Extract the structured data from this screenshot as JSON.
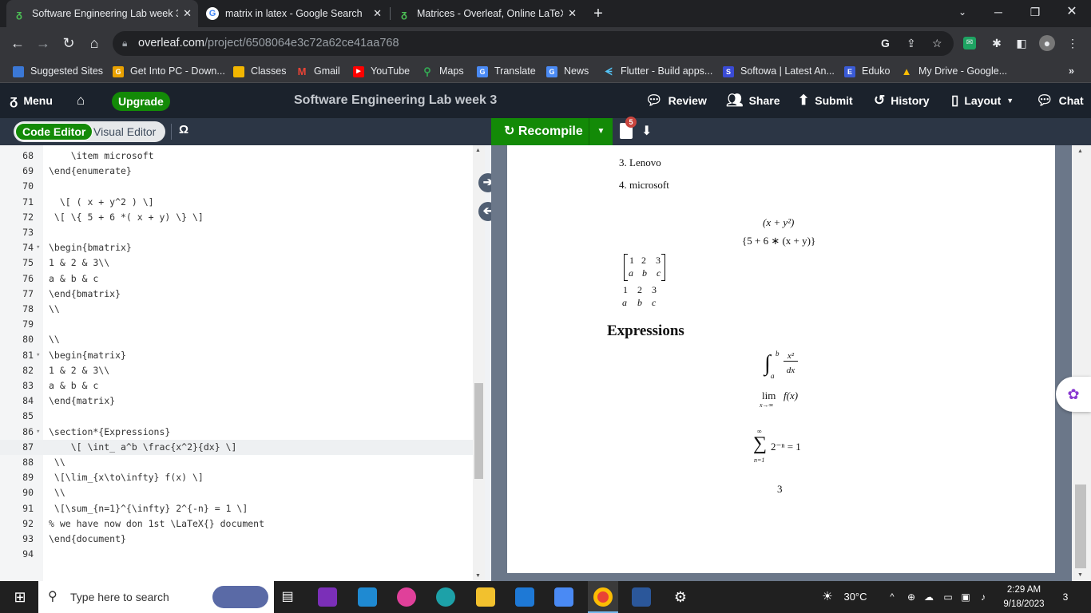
{
  "browser": {
    "tabs": [
      {
        "title": "Software Engineering Lab week 3",
        "icon": "overleaf-icon"
      },
      {
        "title": "matrix in latex - Google Search",
        "icon": "google-icon"
      },
      {
        "title": "Matrices - Overleaf, Online LaTeX",
        "icon": "overleaf-icon"
      }
    ],
    "url_host": "overleaf.com",
    "url_path": "/project/6508064e3c72a62ce41aa768",
    "bookmarks": [
      "Suggested Sites",
      "Get Into PC - Down...",
      "Classes",
      "Gmail",
      "YouTube",
      "Maps",
      "Translate",
      "News",
      "Flutter - Build apps...",
      "Softowa | Latest An...",
      "Eduko",
      "My Drive - Google..."
    ]
  },
  "overleaf": {
    "menu": "Menu",
    "upgrade": "Upgrade",
    "project_title": "Software Engineering Lab week 3",
    "review": "Review",
    "share": "Share",
    "submit": "Submit",
    "history": "History",
    "layout": "Layout",
    "chat": "Chat",
    "code_editor": "Code Editor",
    "visual_editor": "Visual Editor",
    "omega": "Ω",
    "recompile": "Recompile",
    "logs_badge": "5"
  },
  "editor": {
    "lines": [
      {
        "n": "68",
        "code": "    \\item microsoft"
      },
      {
        "n": "69",
        "code": "\\end{enumerate}"
      },
      {
        "n": "70",
        "code": ""
      },
      {
        "n": "71",
        "code": "  \\[ ( x + y^2 ) \\]"
      },
      {
        "n": "72",
        "code": " \\[ \\{ 5 + 6 *( x + y) \\} \\]"
      },
      {
        "n": "73",
        "code": ""
      },
      {
        "n": "74",
        "code": "\\begin{bmatrix}"
      },
      {
        "n": "75",
        "code": "1 & 2 & 3\\\\"
      },
      {
        "n": "76",
        "code": "a & b & c"
      },
      {
        "n": "77",
        "code": "\\end{bmatrix}"
      },
      {
        "n": "78",
        "code": "\\\\"
      },
      {
        "n": "79",
        "code": ""
      },
      {
        "n": "80",
        "code": "\\\\"
      },
      {
        "n": "81",
        "code": "\\begin{matrix}"
      },
      {
        "n": "82",
        "code": "1 & 2 & 3\\\\"
      },
      {
        "n": "83",
        "code": "a & b & c"
      },
      {
        "n": "84",
        "code": "\\end{matrix}"
      },
      {
        "n": "85",
        "code": ""
      },
      {
        "n": "86",
        "code": "\\section*{Expressions}"
      },
      {
        "n": "87",
        "code": "    \\[ \\int_ a^b \\frac{x^2}{dx} \\]"
      },
      {
        "n": "88",
        "code": " \\\\"
      },
      {
        "n": "89",
        "code": " \\[\\lim_{x\\to\\infty} f(x) \\]"
      },
      {
        "n": "90",
        "code": " \\\\"
      },
      {
        "n": "91",
        "code": " \\[\\sum_{n=1}^{\\infty} 2^{-n} = 1 \\]"
      },
      {
        "n": "92",
        "code": "% we have now don 1st \\LaTeX{} document"
      },
      {
        "n": "93",
        "code": "\\end{document}"
      },
      {
        "n": "94",
        "code": ""
      }
    ]
  },
  "pdf": {
    "item3": "3.  Lenovo",
    "item4": "4.  microsoft",
    "eq1": "(x + y²)",
    "eq2": "{5 + 6 ∗ (x + y)}",
    "bmatrix_row1": [
      "1",
      "2",
      "3"
    ],
    "bmatrix_row2": [
      "a",
      "b",
      "c"
    ],
    "matrix_row1": [
      "1",
      "2",
      "3"
    ],
    "matrix_row2": [
      "a",
      "b",
      "c"
    ],
    "section": "Expressions",
    "integral_sym": "∫",
    "integral_lower": "a",
    "integral_upper": "b",
    "frac_num": "x²",
    "frac_den": "dx",
    "lim_text": "lim",
    "lim_sub": "x→∞",
    "lim_fx": "f(x)",
    "sum_sym": "∑",
    "sum_upper": "∞",
    "sum_lower": "n=1",
    "sum_expr": "2⁻ⁿ = 1",
    "page_number": "3"
  },
  "taskbar": {
    "search_placeholder": "Type here to search",
    "temperature": "30°C",
    "time": "2:29 AM",
    "date": "9/18/2023",
    "notif_count": "3"
  }
}
